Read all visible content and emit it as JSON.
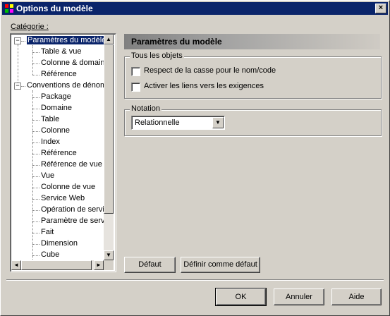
{
  "window": {
    "title": "Options du modèle",
    "close_glyph": "×",
    "app_icon": "model-options-icon"
  },
  "category": {
    "label": "Catégorie :",
    "tree": [
      {
        "label": "Paramètres du modèle",
        "level": 0,
        "expander": "−",
        "selected": true
      },
      {
        "label": "Table & vue",
        "level": 1
      },
      {
        "label": "Colonne & domaine",
        "level": 1
      },
      {
        "label": "Référence",
        "level": 1
      },
      {
        "label": "Conventions de dénom",
        "level": 0,
        "expander": "−"
      },
      {
        "label": "Package",
        "level": 1
      },
      {
        "label": "Domaine",
        "level": 1
      },
      {
        "label": "Table",
        "level": 1
      },
      {
        "label": "Colonne",
        "level": 1
      },
      {
        "label": "Index",
        "level": 1
      },
      {
        "label": "Référence",
        "level": 1
      },
      {
        "label": "Référence de vue",
        "level": 1
      },
      {
        "label": "Vue",
        "level": 1
      },
      {
        "label": "Colonne de vue",
        "level": 1
      },
      {
        "label": "Service Web",
        "level": 1
      },
      {
        "label": "Opération de servic",
        "level": 1
      },
      {
        "label": "Paramètre de servic",
        "level": 1
      },
      {
        "label": "Fait",
        "level": 1
      },
      {
        "label": "Dimension",
        "level": 1
      },
      {
        "label": "Cube",
        "level": 1
      }
    ],
    "scroll_up": "▲",
    "scroll_down": "▼",
    "scroll_left": "◄",
    "scroll_right": "►"
  },
  "panel": {
    "header": "Paramètres du modèle",
    "all_objects_group": "Tous les objets",
    "checkbox_case": "Respect de la casse pour le nom/code",
    "checkbox_case_checked": false,
    "checkbox_links": "Activer les liens vers les exigences",
    "checkbox_links_checked": false,
    "notation_group": "Notation",
    "notation_value": "Relationnelle",
    "dropdown_arrow": "▼"
  },
  "buttons": {
    "default": "Défaut",
    "set_default": "Définir comme défaut",
    "ok": "OK",
    "cancel": "Annuler",
    "help": "Aide"
  }
}
